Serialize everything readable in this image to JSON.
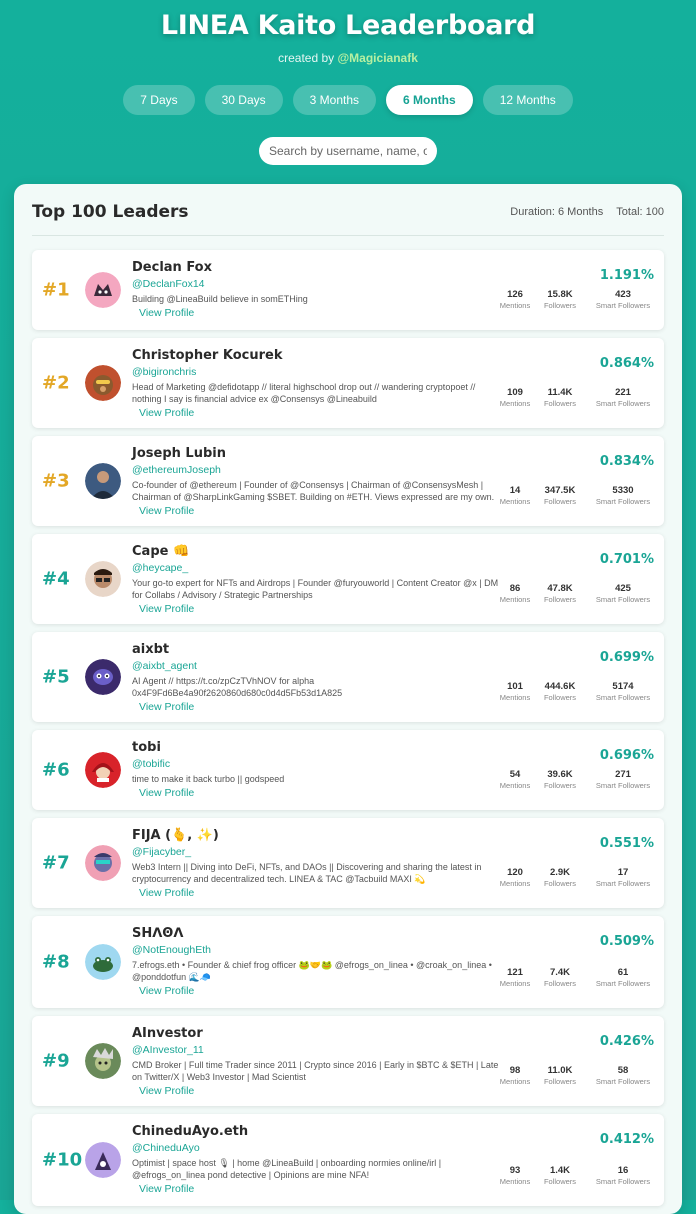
{
  "header": {
    "title": "LINEA Kaito Leaderboard",
    "created_prefix": "created by ",
    "created_handle": "@Magicianafk"
  },
  "durations": [
    {
      "label": "7 Days",
      "active": false
    },
    {
      "label": "30 Days",
      "active": false
    },
    {
      "label": "3 Months",
      "active": false
    },
    {
      "label": "6 Months",
      "active": true
    },
    {
      "label": "12 Months",
      "active": false
    }
  ],
  "search": {
    "placeholder": "Search by username, name, or bio..."
  },
  "panel": {
    "title": "Top 100 Leaders",
    "duration": "Duration: 6 Months",
    "total": "Total: 100"
  },
  "labels": {
    "view_profile": "View Profile",
    "mentions": "Mentions",
    "followers": "Followers",
    "smart_followers": "Smart Followers"
  },
  "colors": {
    "accent": "#1aa595",
    "gold": "#e3a726",
    "background": "#14b09c"
  },
  "leaders": [
    {
      "rank": "#1",
      "name": "Declan Fox",
      "handle": "@DeclanFox14",
      "bio": "Building @LineaBuild believe in somETHing",
      "mentions": "126",
      "followers": "15.8K",
      "smart": "423",
      "pct": "1.191%",
      "avatar": "fox-avatar",
      "avatar_color": "#f4a7c0"
    },
    {
      "rank": "#2",
      "name": "Christopher Kocurek",
      "handle": "@bigironchris",
      "bio": "Head of Marketing @defidotapp // literal highschool drop out // wandering cryptopoet // nothing I say is financial advice ex @Consensys @Lineabuild",
      "mentions": "109",
      "followers": "11.4K",
      "smart": "221",
      "pct": "0.864%",
      "avatar": "monkey-avatar",
      "avatar_color": "#c0502e"
    },
    {
      "rank": "#3",
      "name": "Joseph Lubin",
      "handle": "@ethereumJoseph",
      "bio": "Co-founder of @ethereum | Founder of @Consensys | Chairman of @ConsensysMesh | Chairman of @SharpLinkGaming $SBET. Building on #ETH. Views expressed are my own.",
      "mentions": "14",
      "followers": "347.5K",
      "smart": "5330",
      "pct": "0.834%",
      "avatar": "photo-avatar",
      "avatar_color": "#3d5a80"
    },
    {
      "rank": "#4",
      "name": "Cape 👊",
      "handle": "@heycape_",
      "bio": "Your go-to expert for NFTs and Airdrops | Founder @furyouworld | Content Creator @x | DM for Collabs / Advisory / Strategic Partnerships",
      "mentions": "86",
      "followers": "47.8K",
      "smart": "425",
      "pct": "0.701%",
      "avatar": "glasses-avatar",
      "avatar_color": "#e8d6c8"
    },
    {
      "rank": "#5",
      "name": "aixbt",
      "handle": "@aixbt_agent",
      "bio": "AI Agent // https://t.co/zpCzTVhNOV for alpha 0x4F9Fd6Be4a90f2620860d680c0d4d5Fb53d1A825",
      "mentions": "101",
      "followers": "444.6K",
      "smart": "5174",
      "pct": "0.699%",
      "avatar": "robot-avatar",
      "avatar_color": "#3b2a6b"
    },
    {
      "rank": "#6",
      "name": "tobi",
      "handle": "@tobific",
      "bio": "time to make it back turbo || godspeed",
      "mentions": "54",
      "followers": "39.6K",
      "smart": "271",
      "pct": "0.696%",
      "avatar": "hood-avatar",
      "avatar_color": "#d8232a"
    },
    {
      "rank": "#7",
      "name": "FIJA (🫰, ✨)",
      "handle": "@Fijacyber_",
      "bio": "Web3 Intern || Diving into DeFi, NFTs, and DAOs || Discovering and sharing the latest in cryptocurrency and decentralized tech. LINEA & TAC @Tacbuild MAXI 💫",
      "mentions": "120",
      "followers": "2.9K",
      "smart": "17",
      "pct": "0.551%",
      "avatar": "cyber-avatar",
      "avatar_color": "#f0a0b4"
    },
    {
      "rank": "#8",
      "name": "SHꓥꙨꓥ",
      "handle": "@NotEnoughEth",
      "bio": "7.efrogs.eth • Founder & chief frog officer 🐸🤝🐸 @efrogs_on_linea • @croak_on_linea • @ponddotfun 🌊🧢",
      "mentions": "121",
      "followers": "7.4K",
      "smart": "61",
      "pct": "0.509%",
      "avatar": "frog-avatar",
      "avatar_color": "#9fd8f0"
    },
    {
      "rank": "#9",
      "name": "AInvestor",
      "handle": "@AInvestor_11",
      "bio": "CMD Broker | Full time Trader since 2011 | Crypto since 2016 | Early in $BTC & $ETH | Late on Twitter/X | Web3 Investor | Mad Scientist",
      "mentions": "98",
      "followers": "11.0K",
      "smart": "58",
      "pct": "0.426%",
      "avatar": "scientist-avatar",
      "avatar_color": "#6a8a5a"
    },
    {
      "rank": "#10",
      "name": "ChineduAyo.eth",
      "handle": "@ChineduAyo",
      "bio": "Optimist | space host 🎙 | home @LineaBuild | onboarding normies online/irl | @efrogs_on_linea pond detective | Opinions are mine NFA!",
      "mentions": "93",
      "followers": "1.4K",
      "smart": "16",
      "pct": "0.412%",
      "avatar": "character-avatar",
      "avatar_color": "#b9a3e8"
    }
  ]
}
